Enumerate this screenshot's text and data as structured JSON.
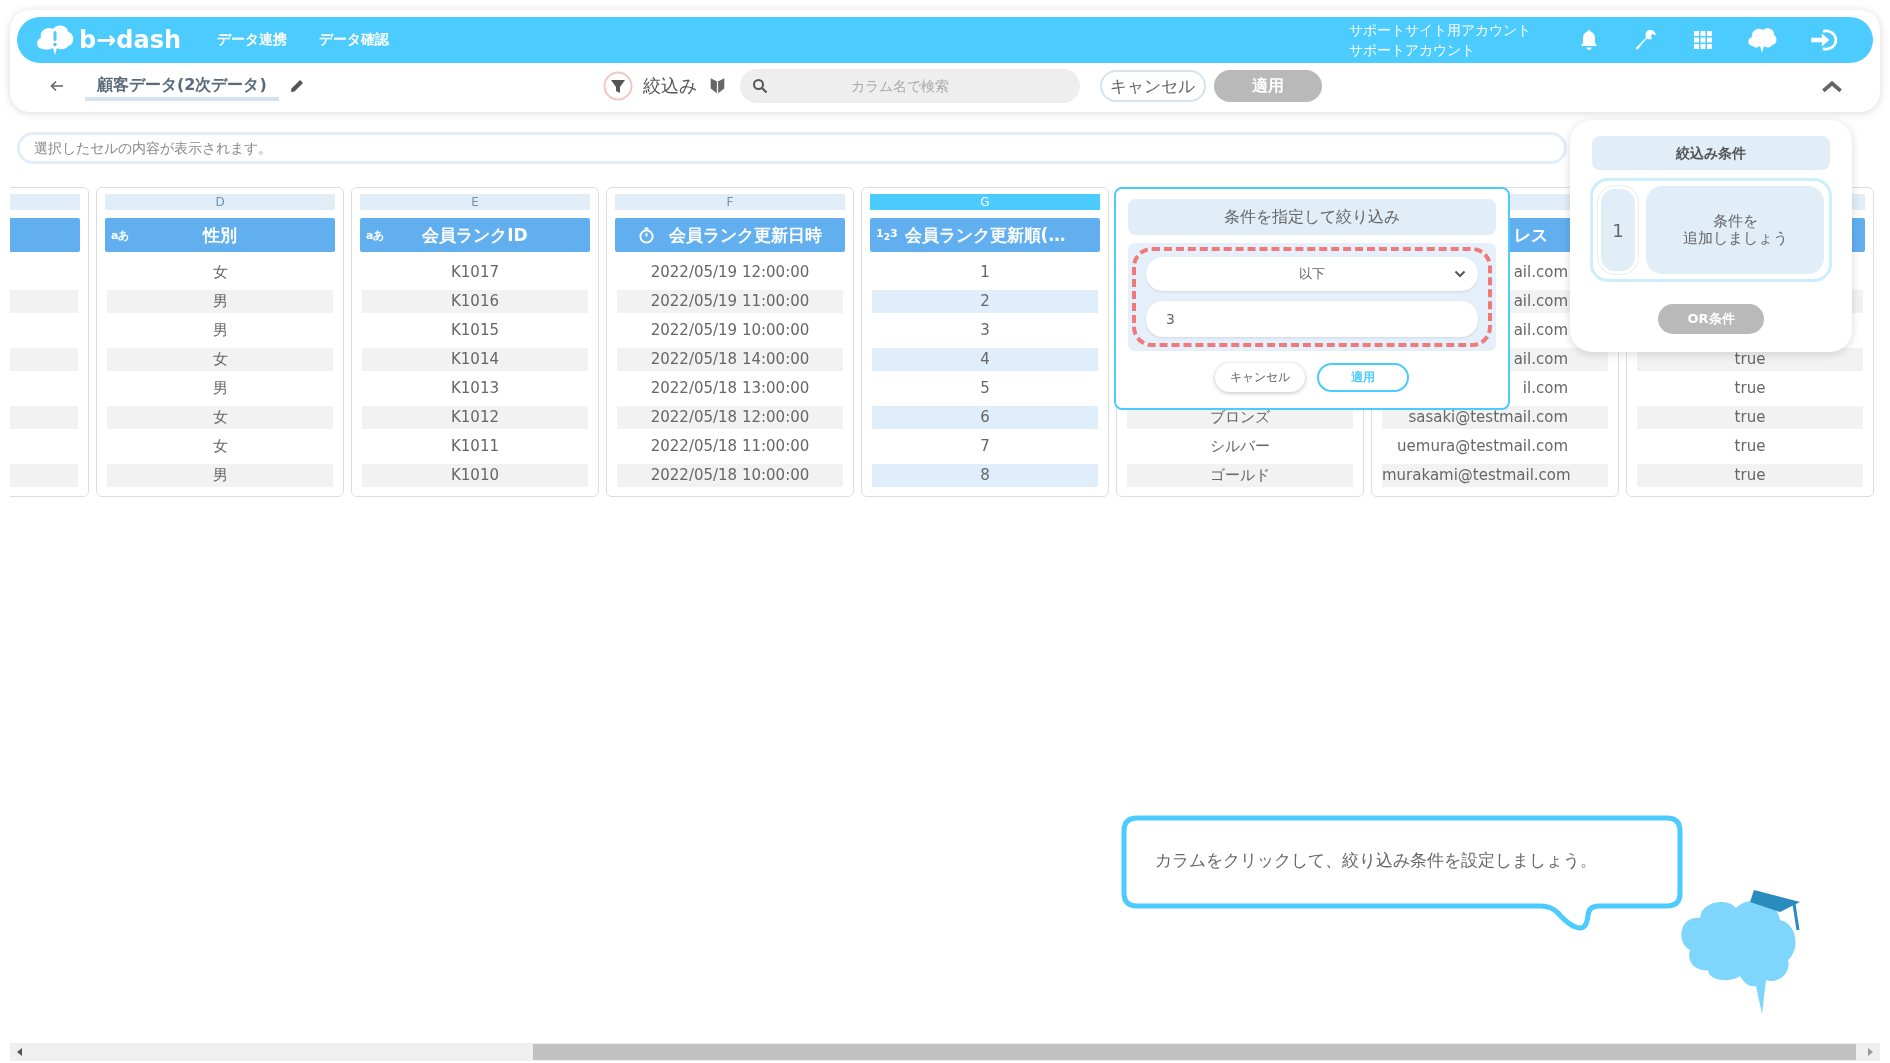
{
  "header": {
    "logo": "b→dash",
    "nav": [
      {
        "label": "データ連携"
      },
      {
        "label": "データ確認"
      }
    ],
    "account": [
      "サポートサイト用アカウント",
      "サポートアカウント"
    ]
  },
  "toolbar": {
    "title": "顧客データ(2次データ)",
    "filter_label": "絞込み",
    "search": {
      "placeholder": "カラム名で検索"
    },
    "cancel": "キャンセル",
    "apply": {
      "label": "適用",
      "disabled": true
    }
  },
  "cell_preview": {
    "placeholder": "選択したセルの内容が表示されます。"
  },
  "columns": [
    {
      "selected": false
    },
    {
      "letter": "D",
      "selected": false,
      "kind": "text",
      "type_mark": "aあ",
      "header": "性別",
      "cells": [
        "女",
        "男",
        "男",
        "女",
        "男",
        "女",
        "女",
        "男"
      ]
    },
    {
      "letter": "E",
      "selected": false,
      "kind": "text",
      "type_mark": "aあ",
      "header": "会員ランクID",
      "cells": [
        "K1017",
        "K1016",
        "K1015",
        "K1014",
        "K1013",
        "K1012",
        "K1011",
        "K1010"
      ]
    },
    {
      "letter": "F",
      "selected": false,
      "kind": "datetime",
      "header": "会員ランク更新日時",
      "cells": [
        "2022/05/19 12:00:00",
        "2022/05/19 11:00:00",
        "2022/05/19 10:00:00",
        "2022/05/18 14:00:00",
        "2022/05/18 13:00:00",
        "2022/05/18 12:00:00",
        "2022/05/18 11:00:00",
        "2022/05/18 10:00:00"
      ]
    },
    {
      "letter": "G",
      "selected": true,
      "kind": "number",
      "type_mark": "1$_{2}$3",
      "header": "会員ランク更新順(…",
      "cells": [
        "1",
        "2",
        "3",
        "4",
        "5",
        "6",
        "7",
        "8"
      ]
    },
    {
      "cells": [
        "ブロンズ",
        "シルバー",
        "ゴールド"
      ]
    },
    {
      "selected": false,
      "clipped": true,
      "header": "レス",
      "cells": [
        "ail.com",
        "ail.com",
        "ail.com",
        "ail.com",
        "il.com",
        "sasaki@testmail.com",
        "uemura@testmail.com",
        "murakami@testmail.com"
      ]
    },
    {
      "selected": false,
      "cells": [
        "true",
        "true",
        "true",
        "true",
        "true"
      ]
    }
  ],
  "filter_popup": {
    "title": "条件を指定して絞り込み",
    "operator": "以下",
    "value": "3",
    "highlighted": true,
    "cancel": "キャンセル",
    "apply": "適用"
  },
  "conditions_panel": {
    "title": "絞込み条件",
    "conditions": [
      {
        "number": "1",
        "lines": [
          "条件を",
          "追加しましょう"
        ]
      }
    ],
    "or_button": {
      "label": "OR条件",
      "disabled": true
    }
  },
  "hint_bubble": {
    "text": "カラムをクリックして、絞り込み条件を設定しましょう。"
  }
}
